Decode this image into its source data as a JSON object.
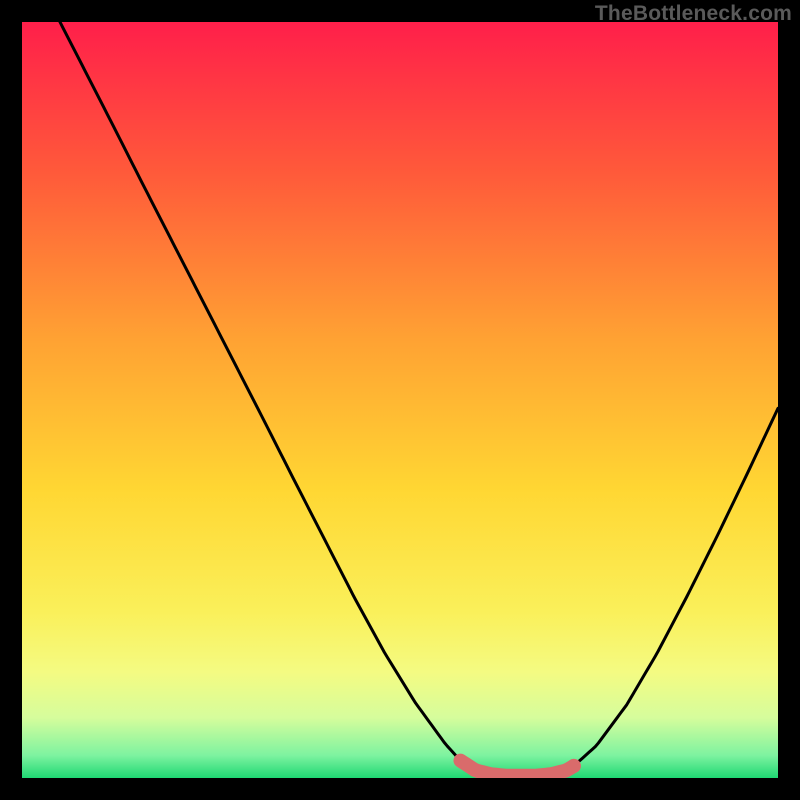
{
  "attribution": "TheBottleneck.com",
  "chart_data": {
    "type": "line",
    "title": "",
    "xlabel": "",
    "ylabel": "",
    "xlim": [
      0,
      100
    ],
    "ylim": [
      0,
      100
    ],
    "plateau_range": [
      58,
      73
    ],
    "marker_x": 73,
    "x": [
      0,
      4,
      8,
      12,
      16,
      20,
      24,
      28,
      32,
      36,
      40,
      44,
      48,
      52,
      56,
      58,
      60,
      62,
      64,
      66,
      68,
      70,
      72,
      73,
      76,
      80,
      84,
      88,
      92,
      96,
      100
    ],
    "values": [
      110,
      102,
      94.2,
      86.4,
      78.5,
      70.7,
      62.9,
      55.1,
      47.3,
      39.4,
      31.6,
      23.8,
      16.5,
      10.0,
      4.5,
      2.3,
      1.0,
      0.5,
      0.3,
      0.3,
      0.3,
      0.5,
      1.0,
      1.6,
      4.3,
      9.7,
      16.5,
      24.1,
      32.1,
      40.4,
      48.9
    ],
    "gradient_stops": [
      {
        "offset": 0.0,
        "color": "#ff1f4a"
      },
      {
        "offset": 0.2,
        "color": "#ff5a3a"
      },
      {
        "offset": 0.42,
        "color": "#ffa233"
      },
      {
        "offset": 0.62,
        "color": "#ffd733"
      },
      {
        "offset": 0.78,
        "color": "#faf05a"
      },
      {
        "offset": 0.86,
        "color": "#f4fb82"
      },
      {
        "offset": 0.92,
        "color": "#d6fd9c"
      },
      {
        "offset": 0.97,
        "color": "#7ef3a0"
      },
      {
        "offset": 1.0,
        "color": "#1fd873"
      }
    ],
    "curve_color": "#000000",
    "plateau_color": "#d96b6b",
    "marker_color": "#d96b6b"
  }
}
